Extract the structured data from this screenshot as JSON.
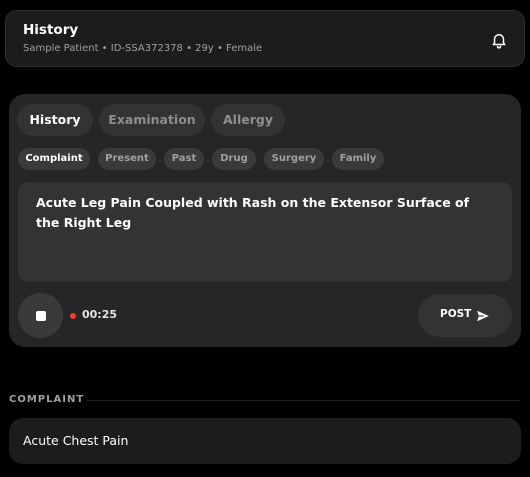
{
  "header": {
    "title": "History",
    "subtitle": "Sample Patient • ID-SSA372378 • 29y • Female",
    "notification_icon": "bell-icon"
  },
  "tabs": [
    {
      "label": "History",
      "active": true
    },
    {
      "label": "Examination",
      "active": false
    },
    {
      "label": "Allergy",
      "active": false
    }
  ],
  "chips": [
    {
      "label": "Complaint",
      "active": true
    },
    {
      "label": "Present",
      "active": false
    },
    {
      "label": "Past",
      "active": false
    },
    {
      "label": "Drug",
      "active": false
    },
    {
      "label": "Surgery",
      "active": false
    },
    {
      "label": "Family",
      "active": false
    }
  ],
  "editor": {
    "text": "Acute Leg Pain Coupled with Rash on the Extensor Surface of the Right Leg"
  },
  "recorder": {
    "timer": "00:25",
    "stop_icon": "stop-icon",
    "status_color": "#ff3b30"
  },
  "post": {
    "label": "POST",
    "icon": "send-icon"
  },
  "complaints": {
    "section_label": "COMPLAINT",
    "items": [
      "Acute Chest Pain"
    ]
  }
}
